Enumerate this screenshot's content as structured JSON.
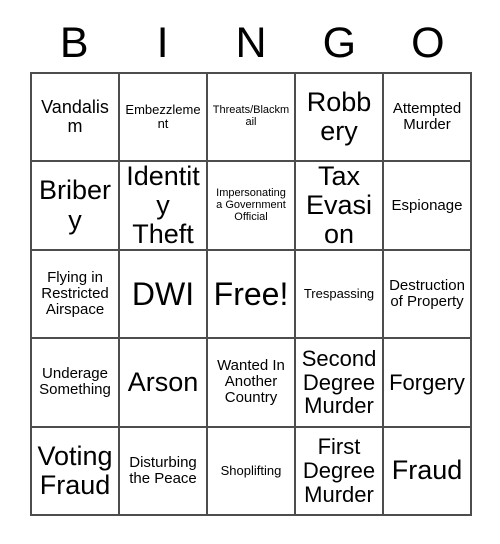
{
  "card": {
    "title": "Bingo Card",
    "header_letters": [
      "B",
      "I",
      "N",
      "G",
      "O"
    ],
    "columns": 5,
    "rows": 5,
    "grid_line_color": "#4d4d4d",
    "background_color": "#ffffff",
    "text_color": "#000000",
    "free_space": {
      "row": 3,
      "column": 3,
      "label": "Free!"
    },
    "cells": [
      [
        {
          "label": "Vandalism",
          "size": "fs-l"
        },
        {
          "label": "Embezzlement",
          "size": "fs-s"
        },
        {
          "label": "Threats/Blackmail",
          "size": "fs-xs"
        },
        {
          "label": "Robbery",
          "size": "fs-xxl"
        },
        {
          "label": "Attempted Murder",
          "size": "fs-m"
        }
      ],
      [
        {
          "label": "Bribery",
          "size": "fs-xxl"
        },
        {
          "label": "Identity Theft",
          "size": "fs-xxl"
        },
        {
          "label": "Impersonating a Government Official",
          "size": "fs-xs"
        },
        {
          "label": "Tax Evasion",
          "size": "fs-xxl"
        },
        {
          "label": "Espionage",
          "size": "fs-m"
        }
      ],
      [
        {
          "label": "Flying in Restricted Airspace",
          "size": "fs-m"
        },
        {
          "label": "DWI",
          "size": "fs-huge"
        },
        {
          "label": "Free!",
          "size": "fs-huge"
        },
        {
          "label": "Trespassing",
          "size": "fs-s"
        },
        {
          "label": "Destruction of Property",
          "size": "fs-m"
        }
      ],
      [
        {
          "label": "Underage Something",
          "size": "fs-m"
        },
        {
          "label": "Arson",
          "size": "fs-xxl"
        },
        {
          "label": "Wanted In Another Country",
          "size": "fs-m"
        },
        {
          "label": "Second Degree Murder",
          "size": "fs-xl"
        },
        {
          "label": "Forgery",
          "size": "fs-xl"
        }
      ],
      [
        {
          "label": "Voting Fraud",
          "size": "fs-xxl"
        },
        {
          "label": "Disturbing the Peace",
          "size": "fs-m"
        },
        {
          "label": "Shoplifting",
          "size": "fs-s"
        },
        {
          "label": "First Degree Murder",
          "size": "fs-xl"
        },
        {
          "label": "Fraud",
          "size": "fs-xxl"
        }
      ]
    ]
  }
}
